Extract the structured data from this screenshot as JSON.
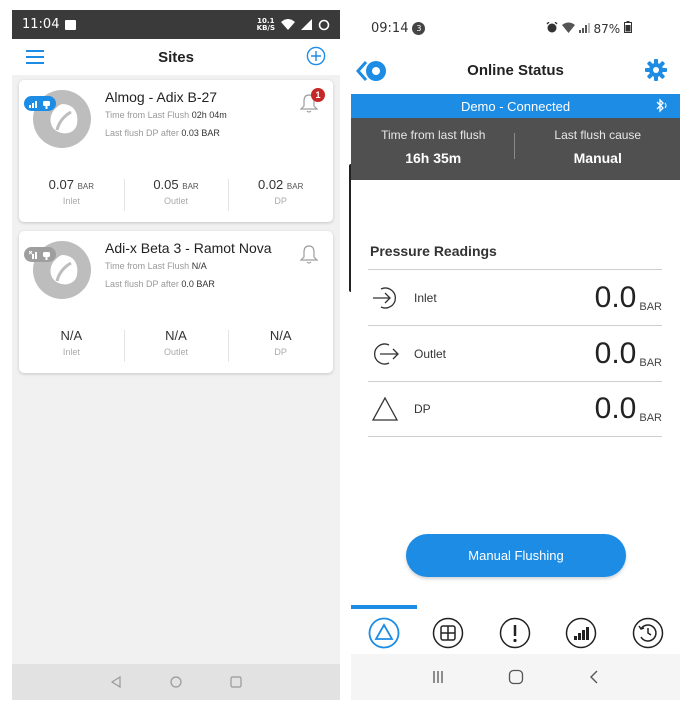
{
  "left": {
    "status": {
      "time": "11:04",
      "rate_top": "10.1",
      "rate_bottom": "KB/S"
    },
    "header": {
      "title": "Sites"
    },
    "sites": [
      {
        "name": "Almog - Adix B-27",
        "time_label": "Time from Last Flush",
        "time_value": "02h 04m",
        "dp_label": "Last flush DP after",
        "dp_value": "0.03 BAR",
        "notification_count": "1",
        "stats": [
          {
            "value": "0.07",
            "unit": "BAR",
            "caption": "Inlet"
          },
          {
            "value": "0.05",
            "unit": "BAR",
            "caption": "Outlet"
          },
          {
            "value": "0.02",
            "unit": "BAR",
            "caption": "DP"
          }
        ]
      },
      {
        "name": "Adi-x Beta 3 - Ramot Nova",
        "time_label": "Time from Last Flush",
        "time_value": "N/A",
        "dp_label": "Last flush DP after",
        "dp_value": "0.0 BAR",
        "stats": [
          {
            "value": "N/A",
            "unit": "",
            "caption": "Inlet"
          },
          {
            "value": "N/A",
            "unit": "",
            "caption": "Outlet"
          },
          {
            "value": "N/A",
            "unit": "",
            "caption": "DP"
          }
        ]
      }
    ]
  },
  "right": {
    "status": {
      "time": "09:14",
      "notif": "3",
      "battery": "87%"
    },
    "header": {
      "title": "Online Status"
    },
    "connection": "Demo - Connected",
    "flush": {
      "time_label": "Time from last flush",
      "time_value": "16h 35m",
      "cause_label": "Last flush cause",
      "cause_value": "Manual"
    },
    "pressure": {
      "title": "Pressure Readings",
      "rows": [
        {
          "label": "Inlet",
          "value": "0.0",
          "unit": "BAR",
          "icon": "inlet-arrow-icon"
        },
        {
          "label": "Outlet",
          "value": "0.0",
          "unit": "BAR",
          "icon": "outlet-arrow-icon"
        },
        {
          "label": "DP",
          "value": "0.0",
          "unit": "BAR",
          "icon": "triangle-icon"
        }
      ]
    },
    "button": "Manual Flushing",
    "tabs": [
      "triangle-tab-icon",
      "grid-tab-icon",
      "alert-tab-icon",
      "signal-tab-icon",
      "history-tab-icon"
    ]
  },
  "colors": {
    "accent": "#1c8ce5",
    "dark_bar": "#505050",
    "alert": "#c62828"
  }
}
